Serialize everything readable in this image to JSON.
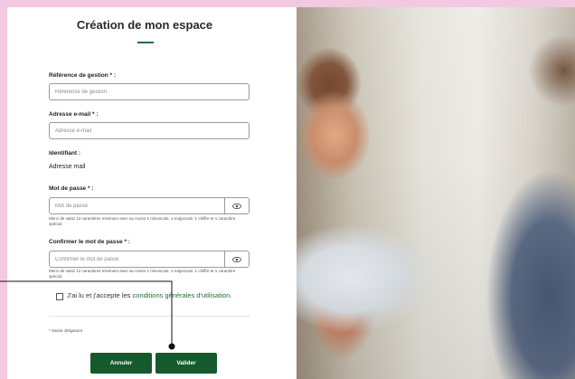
{
  "form": {
    "title": "Création de mon espace",
    "ref_label": "Référence de gestion * :",
    "ref_placeholder": "Référence de gestion",
    "email_label": "Adresse e-mail * :",
    "email_placeholder": "Adresse e-mail",
    "identifiant_label": "Identifiant :",
    "identifiant_value": "Adresse mail",
    "password_label": "Mot de passe * :",
    "password_placeholder": "Mot de passe",
    "password_help": "Merci de saisir 12 caractères minimum avec au moins 1 minuscule, 1 majuscule, 1 chiffre et 1 caractère spécial.",
    "confirm_label": "Confirmer le mot de passe * :",
    "confirm_placeholder": "Confirmer le mot de passe",
    "confirm_help": "Merci de saisir 12 caractères minimum avec au moins 1 minuscule, 1 majuscule, 1 chiffre et 1 caractère spécial.",
    "cgu_prefix": "J'ai lu et j'accepte les ",
    "cgu_link": "conditions générales d'utilisation",
    "cgu_suffix": ".",
    "required_note": "* Saisie obligatoire",
    "cancel_label": "Annuler",
    "submit_label": "Valider"
  },
  "icons": {
    "password_toggle": "eye-icon",
    "confirm_toggle": "eye-icon"
  },
  "colors": {
    "page_background": "#f2c9e0",
    "accent_green": "#155a2d",
    "link_green": "#1d6f3a"
  }
}
